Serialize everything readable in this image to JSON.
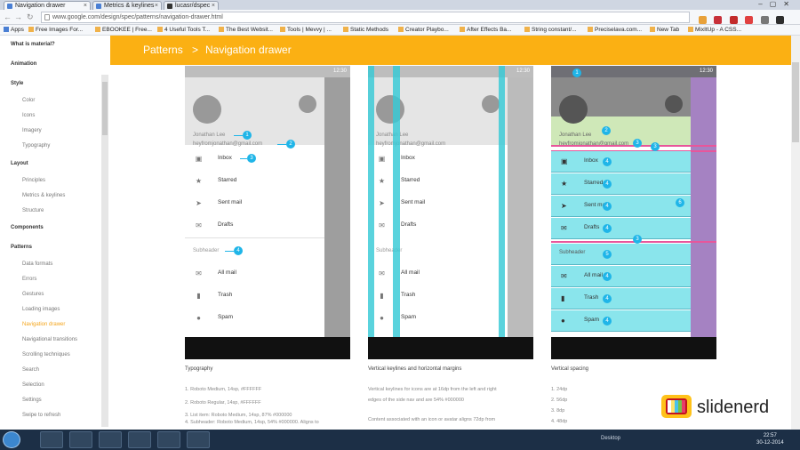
{
  "browser": {
    "tabs": [
      {
        "label": "Navigation drawer"
      },
      {
        "label": "Metrics & keylines"
      },
      {
        "label": "lucasr/dspec"
      }
    ],
    "url": "www.google.com/design/spec/patterns/navigation-drawer.html",
    "bookmarks": [
      {
        "label": "Apps"
      },
      {
        "label": "Free Images For..."
      },
      {
        "label": "EBOOKEE | Free..."
      },
      {
        "label": "4 Useful Tools T..."
      },
      {
        "label": "The Best Websit..."
      },
      {
        "label": "Tools | Mevvy | ..."
      },
      {
        "label": "Static Methods"
      },
      {
        "label": "Creator Playbo..."
      },
      {
        "label": "After Effects Ba..."
      },
      {
        "label": "String constant/..."
      },
      {
        "label": "Preciselava.com..."
      },
      {
        "label": "New Tab"
      },
      {
        "label": "MixItUp - A CSS..."
      }
    ]
  },
  "sidebar": {
    "items": [
      {
        "label": "What is material?"
      },
      {
        "label": "Animation"
      },
      {
        "label": "Style"
      },
      {
        "label": "Color"
      },
      {
        "label": "Icons"
      },
      {
        "label": "Imagery"
      },
      {
        "label": "Typography"
      },
      {
        "label": "Layout"
      },
      {
        "label": "Principles"
      },
      {
        "label": "Metrics & keylines"
      },
      {
        "label": "Structure"
      },
      {
        "label": "Components"
      },
      {
        "label": "Patterns"
      },
      {
        "label": "Data formats"
      },
      {
        "label": "Errors"
      },
      {
        "label": "Gestures"
      },
      {
        "label": "Loading images"
      },
      {
        "label": "Navigation drawer"
      },
      {
        "label": "Navigational transitions"
      },
      {
        "label": "Scrolling techniques"
      },
      {
        "label": "Search"
      },
      {
        "label": "Selection"
      },
      {
        "label": "Settings"
      },
      {
        "label": "Swipe to refresh"
      }
    ]
  },
  "banner": {
    "crumb1": "Patterns",
    "separator": ">",
    "crumb2": "Navigation drawer"
  },
  "drawer": {
    "time": "12:30",
    "user_name": "Jonathan Lee",
    "user_email": "heyfromjonathan@gmail.com",
    "items": [
      {
        "label": "Inbox"
      },
      {
        "label": "Starred"
      },
      {
        "label": "Sent mail"
      },
      {
        "label": "Drafts"
      },
      {
        "label": "All mail"
      },
      {
        "label": "Trash"
      },
      {
        "label": "Spam"
      }
    ],
    "subheader": "Subheader"
  },
  "badges": {
    "one": "1",
    "two": "2",
    "three": "3",
    "four": "4",
    "five": "5",
    "six": "6"
  },
  "panels": {
    "typography": {
      "caption": "Typography",
      "lines": [
        "1. Roboto Medium, 14sp, #FFFFFF",
        "2. Roboto Regular, 14sp, #FFFFFF",
        "3. List item: Roboto Medium, 14sp, 87% #000000",
        "4. Subheader: Roboto Medium, 14sp, 54% #000000. Aligns to"
      ]
    },
    "keylines": {
      "caption": "Vertical keylines and horizontal margins",
      "lines": [
        "Vertical keylines for icons are at 16dp from the left and right",
        "edges of the side nav and are 54% #000000",
        "Content associated with an icon or avatar aligns 72dp from"
      ]
    },
    "spacing": {
      "caption": "Vertical spacing",
      "lines": [
        "1. 24dp",
        "2. 56dp",
        "3. 8dp",
        "4. 48dp"
      ]
    }
  },
  "taskbar": {
    "desktop_label": "Desktop",
    "time": "22:57",
    "date": "30-12-2014"
  },
  "watermark": {
    "text": "slidenerd"
  },
  "colors": {
    "accent": "#fbb013",
    "keyline": "#36c9d6",
    "badge": "#1fb5e8"
  }
}
